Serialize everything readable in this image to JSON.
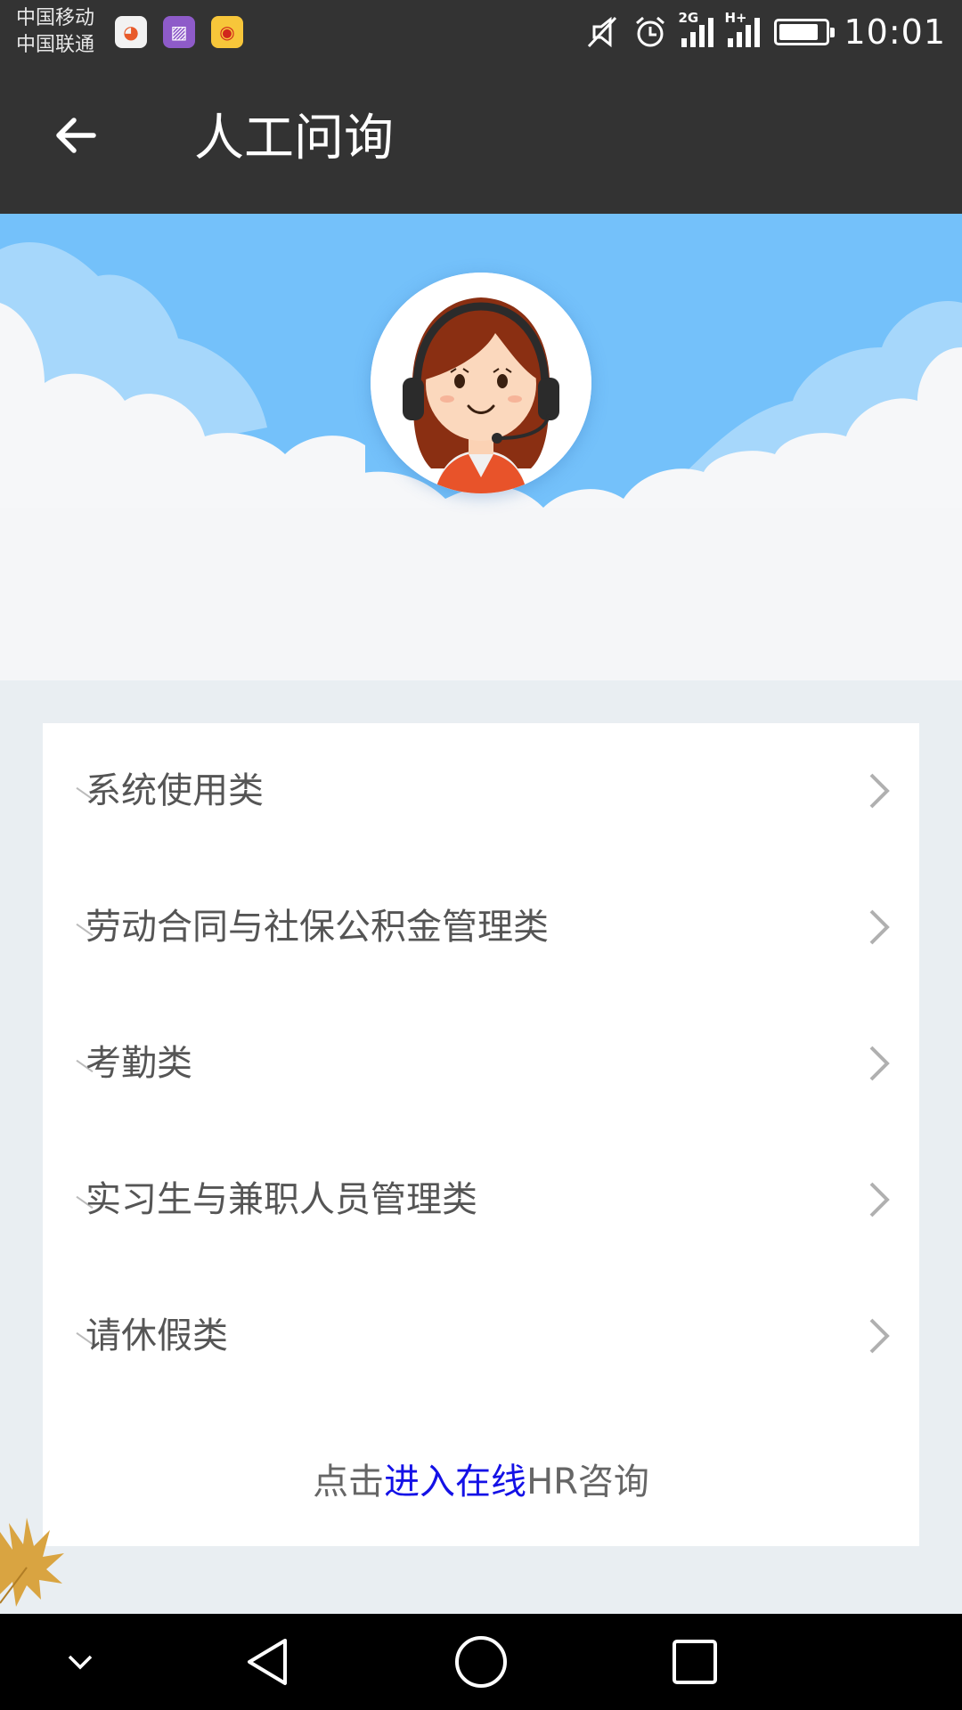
{
  "status_bar": {
    "carrier_1": "中国移动",
    "carrier_2": "中国联通",
    "notification_icons": [
      "browser-app-icon",
      "gallery-app-icon",
      "weibo-app-icon"
    ],
    "network_1": "2G",
    "network_2": "H+",
    "battery_level": 0.85,
    "time": "10:01"
  },
  "app_bar": {
    "title": "人工问询",
    "back_icon": "arrow-left-icon"
  },
  "banner": {
    "avatar_icon": "customer-service-agent-icon",
    "sky_color": "#74c1fa"
  },
  "categories": [
    {
      "label": "系统使用类"
    },
    {
      "label": "劳动合同与社保公积金管理类"
    },
    {
      "label": "考勤类"
    },
    {
      "label": "实习生与兼职人员管理类"
    },
    {
      "label": "请休假类"
    }
  ],
  "footer": {
    "prefix": "点击",
    "link": "进入在线",
    "suffix": "HR咨询",
    "link_color": "#1411e6"
  },
  "nav_bar": {
    "icons": [
      "chevron-down-icon",
      "back-triangle-icon",
      "home-circle-icon",
      "recents-square-icon"
    ]
  }
}
